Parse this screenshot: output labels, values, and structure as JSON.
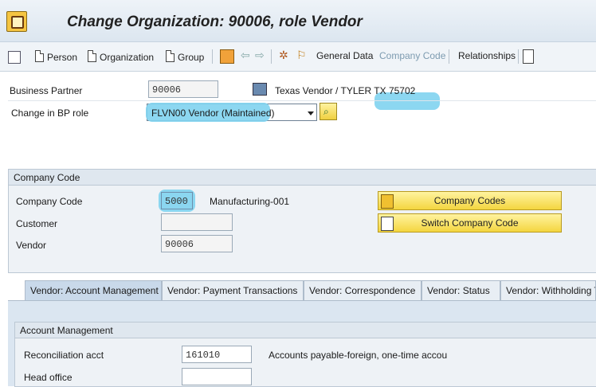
{
  "title": "Change Organization: 90006, role Vendor",
  "toolbar": {
    "person": "Person",
    "organization": "Organization",
    "group": "Group",
    "general_data": "General Data",
    "company_code": "Company Code",
    "relationships": "Relationships"
  },
  "header": {
    "bp_label": "Business Partner",
    "bp_value": "90006",
    "bp_desc": "Texas Vendor / TYLER TX 75702",
    "role_label": "Change in BP role",
    "role_value": "FLVN00 Vendor (Maintained)"
  },
  "company_panel": {
    "title": "Company Code",
    "cc_label": "Company Code",
    "cc_value": "5000",
    "cc_desc": "Manufacturing-001",
    "customer_label": "Customer",
    "customer_value": "",
    "vendor_label": "Vendor",
    "vendor_value": "90006",
    "btn_company_codes": "Company Codes",
    "btn_switch": "Switch Company Code"
  },
  "tabs": [
    {
      "label": "Vendor: Account Management"
    },
    {
      "label": "Vendor: Payment Transactions"
    },
    {
      "label": "Vendor: Correspondence"
    },
    {
      "label": "Vendor: Status"
    },
    {
      "label": "Vendor: Withholding T"
    }
  ],
  "account_mgmt": {
    "title": "Account Management",
    "recon_label": "Reconciliation acct",
    "recon_value": "161010",
    "recon_desc": "Accounts payable-foreign, one-time accou",
    "head_office_label": "Head office",
    "head_office_value": ""
  },
  "colors": {
    "highlight": "#7fd3f0",
    "button": "#f4d640"
  }
}
